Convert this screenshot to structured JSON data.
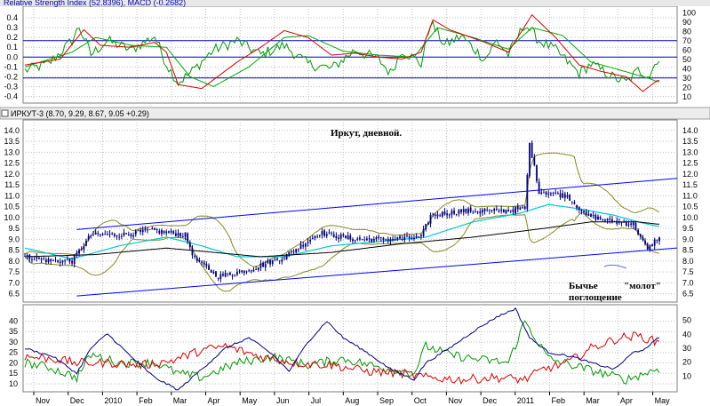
{
  "panels": {
    "top": {
      "header_label": "Relative Strength Index (52.8396), MACD (-0.2682)",
      "macd_ticks": [
        "0.4",
        "0.3",
        "0.2",
        "0.1",
        "0.0",
        "-0.1",
        "-0.2",
        "-0.3",
        "-0.4"
      ],
      "rsi_ticks": [
        "100",
        "90",
        "80",
        "70",
        "60",
        "50",
        "40",
        "30",
        "20",
        "10"
      ]
    },
    "main": {
      "header_label": "ИРКУТ-3 (8.70, 9.29, 8.67, 9.05 +0.29)",
      "title": "Иркут, дневной.",
      "annotation_engulfing_1": "Бычье",
      "annotation_engulfing_2": "поглощение",
      "annotation_hammer": "\"молот\"",
      "price_ticks": [
        "14.0",
        "13.5",
        "13.0",
        "12.5",
        "12.0",
        "11.5",
        "11.0",
        "10.5",
        "10.0",
        "9.5",
        "9.0",
        "8.5",
        "8.0",
        "7.5",
        "7.0",
        "6.5"
      ]
    },
    "bottom": {
      "left_ticks": [
        "40",
        "35",
        "30",
        "25",
        "20",
        "15",
        "10"
      ],
      "right_ticks": [
        "50",
        "40",
        "30",
        "20",
        "10"
      ]
    }
  },
  "x_axis": {
    "labels": [
      "Nov",
      "Dec",
      "2010",
      "Feb",
      "Mar",
      "Apr",
      "May",
      "Jun",
      "Jul",
      "Aug",
      "Sep",
      "Oct",
      "Nov",
      "Dec",
      "2011",
      "Feb",
      "Mar",
      "Apr",
      "May"
    ]
  },
  "colors": {
    "candles": "#000080",
    "sma_long": "#000000",
    "sma_short": "#00c8d8",
    "bollinger": "#8a8a1a",
    "channel": "#0000ff",
    "rsi": "#009900",
    "macd": "#dd0000",
    "signal": "#00aa00",
    "adx": "#000080",
    "di_plus": "#009900",
    "di_minus": "#dd0000",
    "grid": "#c0c0c0"
  },
  "chart_data": [
    {
      "type": "line",
      "name": "RSI / MACD",
      "y_left_range": [
        -0.45,
        0.5
      ],
      "y_right_range": [
        5,
        105
      ],
      "rsi_levels": [
        30,
        70
      ],
      "macd_zero": 0,
      "rsi_key": [
        [
          0,
          38
        ],
        [
          10,
          45
        ],
        [
          20,
          70
        ],
        [
          23,
          85
        ],
        [
          28,
          55
        ],
        [
          35,
          70
        ],
        [
          45,
          60
        ],
        [
          55,
          75
        ],
        [
          60,
          45
        ],
        [
          65,
          25
        ],
        [
          70,
          35
        ],
        [
          80,
          60
        ],
        [
          90,
          70
        ],
        [
          100,
          55
        ],
        [
          110,
          65
        ],
        [
          120,
          45
        ],
        [
          130,
          40
        ],
        [
          140,
          60
        ],
        [
          150,
          50
        ],
        [
          155,
          35
        ],
        [
          160,
          60
        ],
        [
          168,
          45
        ],
        [
          172,
          90
        ],
        [
          178,
          65
        ],
        [
          185,
          75
        ],
        [
          195,
          50
        ],
        [
          200,
          70
        ],
        [
          205,
          55
        ],
        [
          212,
          88
        ],
        [
          218,
          70
        ],
        [
          225,
          60
        ],
        [
          235,
          35
        ],
        [
          240,
          45
        ],
        [
          250,
          30
        ],
        [
          255,
          25
        ],
        [
          260,
          38
        ],
        [
          265,
          33
        ],
        [
          268,
          50
        ]
      ],
      "macd_key": [
        [
          0,
          -0.08
        ],
        [
          15,
          -0.02
        ],
        [
          25,
          0.28
        ],
        [
          32,
          0.12
        ],
        [
          45,
          0.1
        ],
        [
          55,
          0.15
        ],
        [
          60,
          0.05
        ],
        [
          65,
          -0.28
        ],
        [
          75,
          -0.32
        ],
        [
          90,
          -0.05
        ],
        [
          100,
          0.1
        ],
        [
          110,
          0.27
        ],
        [
          120,
          0.2
        ],
        [
          130,
          0.02
        ],
        [
          140,
          0.04
        ],
        [
          150,
          0.0
        ],
        [
          160,
          -0.02
        ],
        [
          168,
          0.05
        ],
        [
          173,
          0.38
        ],
        [
          180,
          0.28
        ],
        [
          195,
          0.15
        ],
        [
          205,
          0.05
        ],
        [
          215,
          0.43
        ],
        [
          225,
          0.2
        ],
        [
          235,
          -0.08
        ],
        [
          245,
          -0.15
        ],
        [
          255,
          -0.2
        ],
        [
          262,
          -0.35
        ],
        [
          268,
          -0.24
        ]
      ],
      "signal_key": [
        [
          0,
          -0.1
        ],
        [
          20,
          0.05
        ],
        [
          30,
          0.2
        ],
        [
          45,
          0.12
        ],
        [
          60,
          0.1
        ],
        [
          70,
          -0.2
        ],
        [
          80,
          -0.3
        ],
        [
          95,
          -0.1
        ],
        [
          110,
          0.2
        ],
        [
          120,
          0.22
        ],
        [
          135,
          0.06
        ],
        [
          150,
          0.02
        ],
        [
          165,
          0.0
        ],
        [
          175,
          0.3
        ],
        [
          190,
          0.2
        ],
        [
          205,
          0.08
        ],
        [
          215,
          0.3
        ],
        [
          228,
          0.22
        ],
        [
          240,
          -0.05
        ],
        [
          255,
          -0.15
        ],
        [
          265,
          -0.22
        ],
        [
          268,
          -0.25
        ]
      ]
    },
    {
      "type": "candlestick",
      "name": "ИРКУТ-3",
      "y_range": [
        6.2,
        14.4
      ],
      "price_key": [
        [
          0,
          8.2
        ],
        [
          12,
          8.0
        ],
        [
          20,
          8.0
        ],
        [
          28,
          9.2
        ],
        [
          40,
          9.2
        ],
        [
          55,
          9.4
        ],
        [
          68,
          9.2
        ],
        [
          72,
          8.1
        ],
        [
          82,
          7.3
        ],
        [
          95,
          7.6
        ],
        [
          110,
          8.2
        ],
        [
          125,
          9.3
        ],
        [
          140,
          9.0
        ],
        [
          155,
          9.0
        ],
        [
          168,
          9.1
        ],
        [
          172,
          10.1
        ],
        [
          185,
          10.3
        ],
        [
          200,
          10.3
        ],
        [
          212,
          10.4
        ],
        [
          214,
          13.4
        ],
        [
          218,
          11.2
        ],
        [
          230,
          11.0
        ],
        [
          238,
          10.1
        ],
        [
          250,
          9.8
        ],
        [
          258,
          9.7
        ],
        [
          264,
          8.5
        ],
        [
          268,
          9.05
        ]
      ],
      "sma_short_key": [
        [
          0,
          8.6
        ],
        [
          20,
          8.1
        ],
        [
          40,
          8.7
        ],
        [
          60,
          9.1
        ],
        [
          75,
          8.7
        ],
        [
          90,
          8.2
        ],
        [
          110,
          8.2
        ],
        [
          130,
          8.7
        ],
        [
          150,
          8.9
        ],
        [
          170,
          9.1
        ],
        [
          190,
          9.8
        ],
        [
          210,
          10.2
        ],
        [
          222,
          10.6
        ],
        [
          235,
          10.4
        ],
        [
          250,
          10.1
        ],
        [
          260,
          9.8
        ],
        [
          268,
          9.6
        ]
      ],
      "sma_long_key": [
        [
          0,
          8.2
        ],
        [
          30,
          8.3
        ],
        [
          60,
          8.6
        ],
        [
          80,
          8.4
        ],
        [
          100,
          8.2
        ],
        [
          130,
          8.4
        ],
        [
          160,
          8.8
        ],
        [
          190,
          9.1
        ],
        [
          220,
          9.5
        ],
        [
          240,
          9.8
        ],
        [
          260,
          9.8
        ],
        [
          268,
          9.7
        ]
      ],
      "channel_upper": [
        [
          22,
          9.45
        ],
        [
          285,
          11.8
        ]
      ],
      "channel_lower": [
        [
          22,
          6.4
        ],
        [
          285,
          8.6
        ]
      ],
      "series_count": 270
    },
    {
      "type": "line",
      "name": "ADX / DMI",
      "y_left_range": [
        7,
        47
      ],
      "y_right_range": [
        0,
        60
      ],
      "adx_key": [
        [
          0,
          27
        ],
        [
          12,
          23
        ],
        [
          22,
          15
        ],
        [
          28,
          27
        ],
        [
          35,
          34
        ],
        [
          45,
          23
        ],
        [
          55,
          13
        ],
        [
          65,
          7
        ],
        [
          75,
          17
        ],
        [
          85,
          27
        ],
        [
          95,
          32
        ],
        [
          105,
          24
        ],
        [
          112,
          16
        ],
        [
          120,
          30
        ],
        [
          128,
          40
        ],
        [
          135,
          32
        ],
        [
          145,
          25
        ],
        [
          155,
          17
        ],
        [
          165,
          12
        ],
        [
          170,
          20
        ],
        [
          180,
          27
        ],
        [
          190,
          35
        ],
        [
          200,
          42
        ],
        [
          208,
          46
        ],
        [
          214,
          32
        ],
        [
          222,
          25
        ],
        [
          232,
          23
        ],
        [
          240,
          20
        ],
        [
          250,
          17
        ],
        [
          258,
          25
        ],
        [
          264,
          27
        ],
        [
          268,
          32
        ]
      ],
      "di_plus_key": [
        [
          0,
          20
        ],
        [
          10,
          18
        ],
        [
          22,
          13
        ],
        [
          28,
          24
        ],
        [
          40,
          20
        ],
        [
          55,
          20
        ],
        [
          65,
          15
        ],
        [
          75,
          13
        ],
        [
          90,
          20
        ],
        [
          105,
          23
        ],
        [
          120,
          19
        ],
        [
          135,
          22
        ],
        [
          150,
          18
        ],
        [
          165,
          15
        ],
        [
          170,
          28
        ],
        [
          180,
          24
        ],
        [
          190,
          22
        ],
        [
          205,
          20
        ],
        [
          212,
          40
        ],
        [
          222,
          22
        ],
        [
          235,
          18
        ],
        [
          245,
          15
        ],
        [
          255,
          12
        ],
        [
          268,
          17
        ]
      ],
      "di_minus_key": [
        [
          0,
          23
        ],
        [
          12,
          22
        ],
        [
          22,
          20
        ],
        [
          35,
          20
        ],
        [
          50,
          19
        ],
        [
          62,
          21
        ],
        [
          75,
          26
        ],
        [
          85,
          28
        ],
        [
          100,
          23
        ],
        [
          115,
          20
        ],
        [
          130,
          19
        ],
        [
          145,
          16
        ],
        [
          160,
          15
        ],
        [
          170,
          13
        ],
        [
          185,
          12
        ],
        [
          200,
          13
        ],
        [
          212,
          12
        ],
        [
          220,
          17
        ],
        [
          230,
          20
        ],
        [
          240,
          27
        ],
        [
          252,
          32
        ],
        [
          260,
          33
        ],
        [
          268,
          30
        ]
      ]
    }
  ]
}
